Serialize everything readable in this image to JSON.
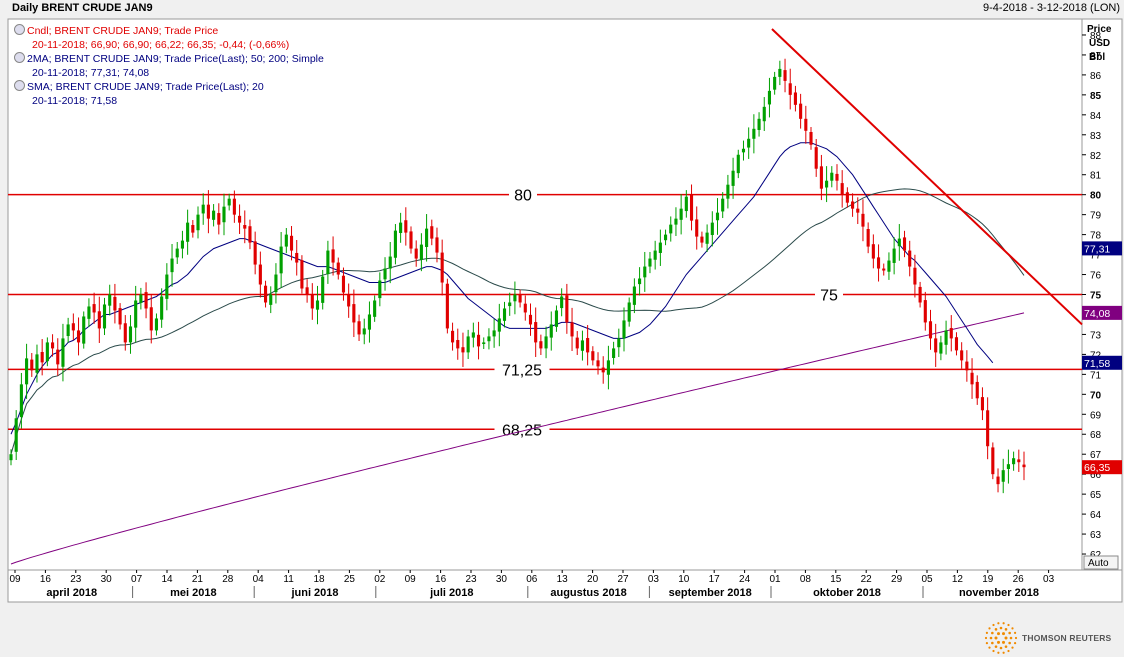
{
  "header": {
    "title": "Daily BRENT CRUDE JAN9",
    "date_range": "9-4-2018 - 3-12-2018 (LON)"
  },
  "legend": [
    {
      "label": "Cndl; BRENT CRUDE JAN9; Trade Price",
      "values": "20-11-2018; 66,90; 66,90; 66,22; 66,35; -0,44; (-0,66%)",
      "color": "#e00000"
    },
    {
      "label": "2MA; BRENT CRUDE JAN9; Trade Price(Last);  50; 200; Simple",
      "values": "20-11-2018; 77,31; 74,08",
      "color": "#000080"
    },
    {
      "label": "SMA; BRENT CRUDE JAN9; Trade Price(Last);  20",
      "values": "20-11-2018; 71,58",
      "color": "#000080"
    }
  ],
  "axis_header": [
    "Price",
    "USD",
    "Bbl"
  ],
  "auto_label": "Auto",
  "logo_text": "THOMSON REUTERS",
  "chart_data": {
    "type": "candlestick",
    "y_axis": {
      "min": 61.2,
      "max": 88.8,
      "ticks": [
        62,
        63,
        64,
        65,
        66,
        67,
        68,
        69,
        70,
        71,
        72,
        73,
        74,
        75,
        76,
        77,
        78,
        79,
        80,
        81,
        82,
        83,
        84,
        85,
        86,
        87,
        88
      ],
      "bold_ticks": [
        70,
        75,
        80,
        85
      ]
    },
    "x_ticks": [
      "09",
      "16",
      "23",
      "30",
      "07",
      "14",
      "21",
      "28",
      "04",
      "11",
      "18",
      "25",
      "02",
      "09",
      "16",
      "23",
      "30",
      "06",
      "13",
      "20",
      "27",
      "03",
      "10",
      "17",
      "24",
      "01",
      "08",
      "15",
      "22",
      "29",
      "05",
      "12",
      "19",
      "26",
      "03"
    ],
    "months": [
      "april 2018",
      "mei 2018",
      "juni 2018",
      "juli 2018",
      "augustus 2018",
      "september 2018",
      "oktober 2018",
      "november 2018"
    ],
    "horizontal_levels": [
      {
        "value": 80,
        "label": "80"
      },
      {
        "value": 75,
        "label": "75"
      },
      {
        "value": 71.25,
        "label": "71,25"
      },
      {
        "value": 68.25,
        "label": "68,25"
      }
    ],
    "trendline": {
      "start": {
        "date": "03-10-2018",
        "value": 88.3
      },
      "end": {
        "date": "03-12-2018",
        "value": 73.5
      }
    },
    "last_value_tags": [
      {
        "value": 77.31,
        "label": "77,31",
        "color": "#000080",
        "series": "2MA 50"
      },
      {
        "value": 74.08,
        "label": "74,08",
        "color": "#800080",
        "series": "2MA 200"
      },
      {
        "value": 71.58,
        "label": "71,58",
        "color": "#000080",
        "series": "SMA 20"
      },
      {
        "value": 66.35,
        "label": "66,35",
        "color": "#e00000",
        "series": "Cndl"
      }
    ],
    "closes": [
      67.0,
      68.8,
      70.5,
      71.8,
      71.2,
      72.0,
      71.6,
      72.6,
      72.3,
      71.5,
      72.8,
      73.5,
      73.2,
      72.6,
      73.9,
      74.4,
      74.1,
      73.3,
      74.5,
      75.0,
      74.2,
      73.5,
      72.6,
      73.4,
      74.7,
      75.0,
      74.3,
      73.2,
      73.8,
      74.9,
      76.0,
      76.8,
      77.3,
      77.7,
      78.6,
      78.1,
      79.0,
      79.5,
      78.8,
      79.2,
      78.5,
      79.4,
      79.8,
      79.0,
      78.6,
      78.3,
      77.6,
      76.5,
      75.5,
      74.6,
      75.0,
      76.0,
      77.4,
      78.0,
      77.2,
      76.6,
      75.3,
      75.0,
      74.3,
      74.7,
      75.9,
      77.2,
      76.6,
      76.0,
      75.1,
      74.4,
      73.6,
      73.0,
      73.3,
      74.0,
      74.7,
      75.7,
      76.3,
      76.9,
      78.2,
      78.6,
      78.1,
      77.3,
      76.8,
      77.5,
      78.3,
      77.8,
      77.1,
      75.6,
      73.3,
      72.6,
      72.3,
      72.1,
      72.9,
      73.1,
      72.4,
      72.6,
      72.9,
      73.2,
      73.8,
      74.3,
      74.6,
      75.0,
      74.6,
      74.1,
      73.5,
      72.6,
      72.3,
      72.9,
      73.5,
      74.2,
      74.9,
      73.6,
      72.9,
      72.3,
      72.7,
      72.1,
      71.7,
      71.4,
      71.1,
      71.7,
      72.3,
      72.8,
      73.7,
      74.6,
      75.4,
      75.8,
      76.4,
      76.8,
      77.2,
      77.6,
      78.0,
      78.5,
      78.8,
      79.3,
      79.9,
      78.7,
      77.9,
      77.6,
      78.1,
      78.6,
      79.1,
      79.8,
      80.5,
      81.2,
      82.0,
      82.3,
      82.8,
      83.3,
      83.8,
      84.4,
      85.2,
      85.9,
      86.3,
      85.7,
      85.0,
      84.5,
      83.8,
      83.2,
      82.5,
      81.3,
      80.3,
      80.7,
      81.1,
      80.7,
      80.0,
      79.6,
      79.3,
      79.1,
      78.4,
      77.4,
      76.8,
      76.3,
      76.2,
      76.7,
      77.3,
      77.8,
      77.2,
      76.4,
      75.5,
      74.6,
      73.6,
      72.8,
      72.1,
      72.6,
      73.2,
      72.8,
      72.2,
      71.7,
      71.2,
      70.5,
      69.8,
      69.2,
      67.4,
      66.0,
      65.5,
      66.2,
      66.5,
      66.8,
      66.6,
      66.35
    ],
    "sma20_start_index": 0,
    "sma20": [
      68.0,
      68.6,
      69.3,
      70.0,
      70.5,
      71.0,
      71.4,
      71.7,
      72.0,
      72.1,
      72.3,
      72.6,
      72.7,
      72.9,
      73.2,
      73.4,
      73.6,
      73.8,
      74.0,
      74.0,
      74.1,
      74.2,
      74.3,
      74.4,
      74.5,
      74.6,
      74.7,
      74.8,
      74.9,
      75.1,
      75.3,
      75.5,
      75.6,
      75.8,
      76.0,
      76.3,
      76.6,
      76.9,
      77.1,
      77.3,
      77.4,
      77.5,
      77.6,
      77.7,
      77.8,
      77.8,
      77.7,
      77.6,
      77.5,
      77.4,
      77.3,
      77.2,
      77.1,
      77.0,
      76.9,
      76.8,
      76.7,
      76.6,
      76.5,
      76.4,
      76.4,
      76.4,
      76.3,
      76.2,
      76.1,
      76.0,
      75.9,
      75.8,
      75.7,
      75.6,
      75.6,
      75.6,
      75.6,
      75.7,
      75.8,
      75.9,
      76.0,
      76.1,
      76.2,
      76.3,
      76.4,
      76.4,
      76.3,
      76.2,
      76.0,
      75.7,
      75.4,
      75.1,
      74.8,
      74.6,
      74.4,
      74.2,
      74.0,
      73.8,
      73.6,
      73.4,
      73.3,
      73.3,
      73.3,
      73.3,
      73.3,
      73.3,
      73.3,
      73.3,
      73.4,
      73.5,
      73.6,
      73.6,
      73.6,
      73.5,
      73.4,
      73.3,
      73.2,
      73.1,
      73.0,
      72.9,
      72.8,
      72.8,
      72.8,
      72.9,
      73.0,
      73.1,
      73.3,
      73.5,
      73.8,
      74.1,
      74.4,
      74.8,
      75.2,
      75.6,
      76.0,
      76.3,
      76.6,
      76.9,
      77.2,
      77.5,
      77.8,
      78.1,
      78.4,
      78.7,
      79.0,
      79.3,
      79.6,
      79.9,
      80.3,
      80.7,
      81.1,
      81.5,
      81.9,
      82.2,
      82.4,
      82.5,
      82.6,
      82.6,
      82.6,
      82.5,
      82.4,
      82.3,
      82.1,
      81.9,
      81.6,
      81.3,
      81.0,
      80.6,
      80.2,
      79.8,
      79.4,
      79.0,
      78.6,
      78.2,
      77.8,
      77.5,
      77.2,
      76.9,
      76.7,
      76.4,
      76.1,
      75.8,
      75.5,
      75.2,
      74.9,
      74.5,
      74.1,
      73.7,
      73.3,
      72.9,
      72.5,
      72.2,
      71.9,
      71.58
    ]
  }
}
